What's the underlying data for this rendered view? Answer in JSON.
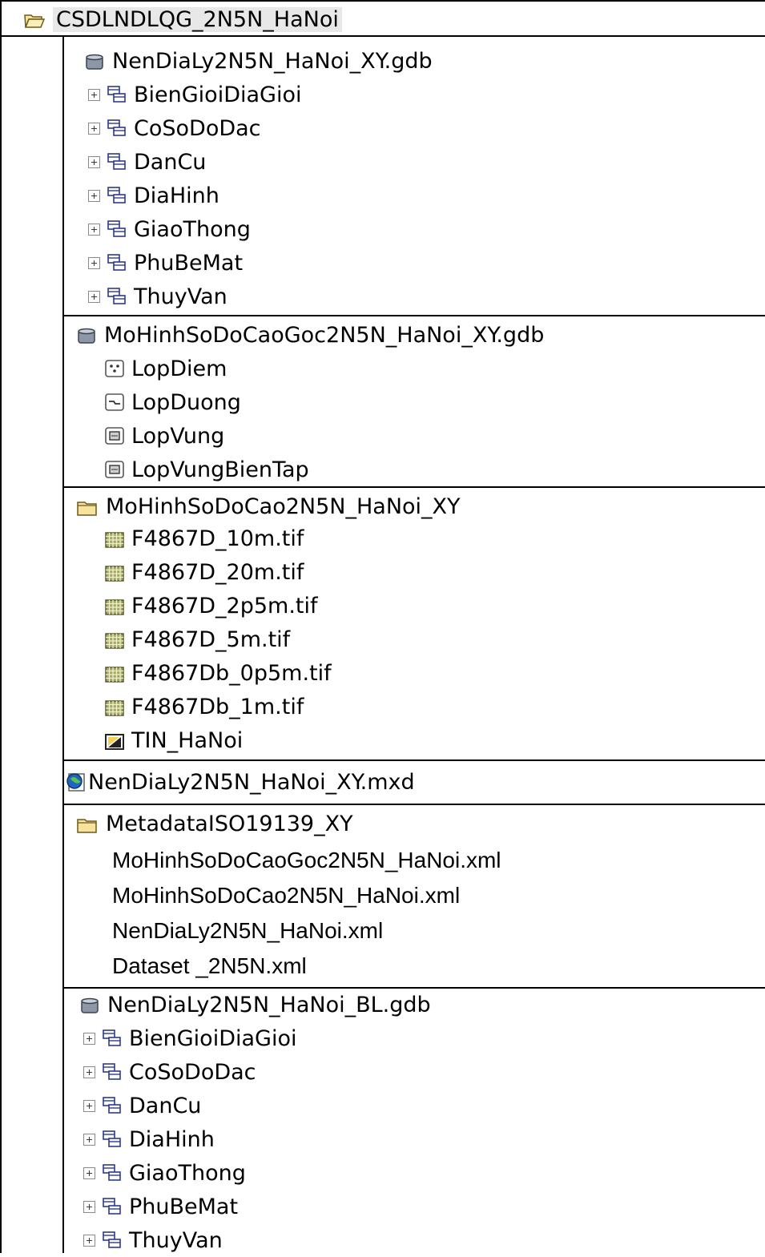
{
  "tree": {
    "root": {
      "label": "CSDLNDLQG_2N5N_HaNoi",
      "icon": "open-folder-icon"
    },
    "groups": [
      {
        "label": "NenDiaLy2N5N_HaNoi_XY.gdb",
        "icon": "geodatabase-icon",
        "items": [
          {
            "label": "BienGioiDiaGioi",
            "icon": "feature-dataset-icon"
          },
          {
            "label": "CoSoDoDac",
            "icon": "feature-dataset-icon"
          },
          {
            "label": "DanCu",
            "icon": "feature-dataset-icon"
          },
          {
            "label": "DiaHinh",
            "icon": "feature-dataset-icon"
          },
          {
            "label": "GiaoThong",
            "icon": "feature-dataset-icon"
          },
          {
            "label": "PhuBeMat",
            "icon": "feature-dataset-icon"
          },
          {
            "label": "ThuyVan",
            "icon": "feature-dataset-icon"
          }
        ]
      },
      {
        "label": "MoHinhSoDoCaoGoc2N5N_HaNoi_XY.gdb",
        "icon": "geodatabase-icon",
        "items": [
          {
            "label": "LopDiem",
            "icon": "point-feature-class-icon"
          },
          {
            "label": "LopDuong",
            "icon": "line-feature-class-icon"
          },
          {
            "label": "LopVung",
            "icon": "polygon-feature-class-icon"
          },
          {
            "label": "LopVungBienTap",
            "icon": "polygon-feature-class-icon"
          }
        ]
      },
      {
        "label": "MoHinhSoDoCao2N5N_HaNoi_XY",
        "icon": "folder-icon",
        "items": [
          {
            "label": "F4867D_10m.tif",
            "icon": "raster-icon"
          },
          {
            "label": "F4867D_20m.tif",
            "icon": "raster-icon"
          },
          {
            "label": "F4867D_2p5m.tif",
            "icon": "raster-icon"
          },
          {
            "label": "F4867D_5m.tif",
            "icon": "raster-icon"
          },
          {
            "label": "F4867Db_0p5m.tif",
            "icon": "raster-icon"
          },
          {
            "label": "F4867Db_1m.tif",
            "icon": "raster-icon"
          },
          {
            "label": "TIN_HaNoi",
            "icon": "tin-icon"
          }
        ]
      },
      {
        "label": "NenDiaLy2N5N_HaNoi_XY.mxd",
        "icon": "map-document-icon",
        "items": []
      },
      {
        "label": "MetadataISO19139_XY",
        "icon": "folder-icon",
        "items": [
          {
            "label": "MoHinhSoDoCaoGoc2N5N_HaNoi.xml"
          },
          {
            "label": "MoHinhSoDoCao2N5N_HaNoi.xml"
          },
          {
            "label": "NenDiaLy2N5N_HaNoi.xml"
          },
          {
            "label": "Dataset _2N5N.xml"
          }
        ]
      },
      {
        "label": "NenDiaLy2N5N_HaNoi_BL.gdb",
        "icon": "geodatabase-icon",
        "items": [
          {
            "label": "BienGioiDiaGioi",
            "icon": "feature-dataset-icon"
          },
          {
            "label": "CoSoDoDac",
            "icon": "feature-dataset-icon"
          },
          {
            "label": "DanCu",
            "icon": "feature-dataset-icon"
          },
          {
            "label": "DiaHinh",
            "icon": "feature-dataset-icon"
          },
          {
            "label": "GiaoThong",
            "icon": "feature-dataset-icon"
          },
          {
            "label": "PhuBeMat",
            "icon": "feature-dataset-icon"
          },
          {
            "label": "ThuyVan",
            "icon": "feature-dataset-icon"
          }
        ]
      }
    ]
  }
}
